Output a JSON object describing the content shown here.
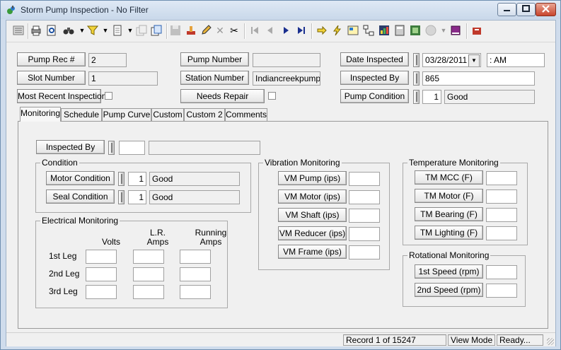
{
  "window": {
    "title": "Storm Pump Inspection - No Filter"
  },
  "header": {
    "pump_rec_label": "Pump Rec #",
    "pump_rec_value": "2",
    "slot_number_label": "Slot Number",
    "slot_number_value": "1",
    "most_recent_label": "Most Recent Inspection",
    "pump_number_label": "Pump Number",
    "pump_number_value": "",
    "station_number_label": "Station Number",
    "station_number_value": "Indiancreekpump1",
    "needs_repair_label": "Needs Repair",
    "date_inspected_label": "Date Inspected",
    "date_inspected_value": "03/28/2011",
    "time_value": ":  AM",
    "inspected_by_label": "Inspected By",
    "inspected_by_value": "865",
    "pump_condition_label": "Pump Condition",
    "pump_condition_code": "1",
    "pump_condition_text": "Good"
  },
  "tabs": [
    "Monitoring",
    "Schedule",
    "Pump Curve",
    "Custom",
    "Custom 2",
    "Comments"
  ],
  "monitoring": {
    "inspected_by_label": "Inspected By",
    "condition": {
      "title": "Condition",
      "motor_label": "Motor Condition",
      "motor_code": "1",
      "motor_text": "Good",
      "seal_label": "Seal Condition",
      "seal_code": "1",
      "seal_text": "Good"
    },
    "electrical": {
      "title": "Electrical Monitoring",
      "col_volts": "Volts",
      "col_lr_amps_1": "L.R.",
      "col_lr_amps_2": "Amps",
      "col_running_1": "Running",
      "col_running_2": "Amps",
      "rows": [
        "1st Leg",
        "2nd Leg",
        "3rd Leg"
      ]
    },
    "vibration": {
      "title": "Vibration Monitoring",
      "items": [
        "VM Pump (ips)",
        "VM Motor (ips)",
        "VM Shaft (ips)",
        "VM Reducer (ips)",
        "VM Frame (ips)"
      ]
    },
    "temperature": {
      "title": "Temperature Monitoring",
      "items": [
        "TM MCC (F)",
        "TM Motor (F)",
        "TM Bearing (F)",
        "TM Lighting (F)"
      ]
    },
    "rotational": {
      "title": "Rotational Monitoring",
      "items": [
        "1st Speed (rpm)",
        "2nd Speed (rpm)"
      ]
    }
  },
  "status": {
    "record": "Record 1 of 15247",
    "mode": "View Mode",
    "state": "Ready..."
  },
  "toolbar_icons": [
    "list-icon",
    "print-icon",
    "print-preview-icon",
    "binoculars-icon",
    "filter-icon",
    "new-record-icon",
    "copy-record-icon",
    "duplicate-icon",
    "save-icon",
    "stamp-icon",
    "edit-pencil-icon",
    "delete-icon",
    "cut-icon",
    "first-record-icon",
    "previous-record-icon",
    "next-record-icon",
    "last-record-icon",
    "arrow-right-icon",
    "lightning-icon",
    "report-icon",
    "tree-icon",
    "chart-icon",
    "calculator-icon",
    "map-icon",
    "globe-icon",
    "book-icon",
    "exit-icon"
  ]
}
